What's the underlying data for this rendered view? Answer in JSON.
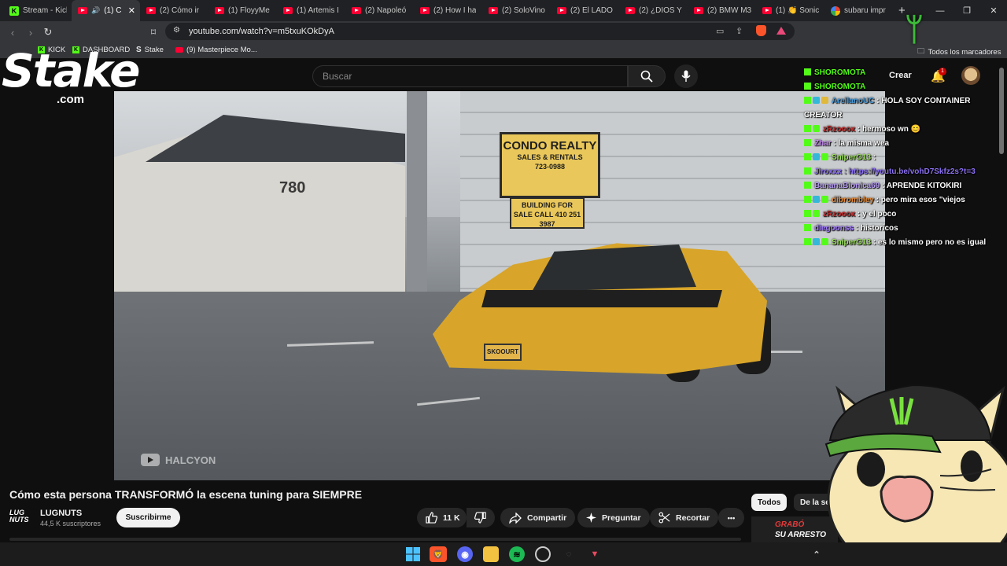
{
  "browser": {
    "tabs": [
      {
        "label": "Stream - Kick",
        "icon": "kick-icon"
      },
      {
        "label": "(1) C",
        "icon": "youtube-icon",
        "active": true
      },
      {
        "label": "(2) Cómo ir",
        "icon": "youtube-icon"
      },
      {
        "label": "(1) FloyyMe",
        "icon": "youtube-icon"
      },
      {
        "label": "(1) Artemis I",
        "icon": "youtube-icon"
      },
      {
        "label": "(2) Napoleó",
        "icon": "youtube-icon"
      },
      {
        "label": "(2) How I ha",
        "icon": "youtube-icon"
      },
      {
        "label": "(2) SoloVino",
        "icon": "youtube-icon"
      },
      {
        "label": "(2) El LADO",
        "icon": "youtube-icon"
      },
      {
        "label": "(2) ¿DIOS Y",
        "icon": "youtube-icon"
      },
      {
        "label": "(2) BMW M3",
        "icon": "youtube-icon"
      },
      {
        "label": "(1) 👏 Sonic",
        "icon": "youtube-icon"
      },
      {
        "label": "subaru impr",
        "icon": "google-icon"
      }
    ],
    "new_tab": "+",
    "url": "youtube.com/watch?v=m5txuKOkDyA",
    "bookmarks": [
      "KICK",
      "DASHBOARD",
      "Stake",
      "(9) Masterpiece Mo..."
    ],
    "all_bookmarks": "Todos los marcadores"
  },
  "youtube": {
    "search_placeholder": "Buscar",
    "create_label": "Crear",
    "notifications_count": "1",
    "video": {
      "watermark": "HALCYON",
      "sign_main": "CONDO REALTY",
      "sign_sub": "SALES & RENTALS",
      "sign_phone": "723-0988",
      "sign2_text": "BUILDING FOR SALE CALL 410 251 3987",
      "building_number": "780",
      "plate": "SKOOURT"
    },
    "title": "Cómo esta persona TRANSFORMÓ la escena tuning para SIEMPRE",
    "channel": {
      "logo_text": "LUG NUTS",
      "name": "LUGNUTS",
      "subscribers": "44,5 K suscriptores",
      "subscribe_label": "Suscribirme"
    },
    "actions": {
      "likes": "11 K",
      "share": "Compartir",
      "ask": "Preguntar",
      "clip": "Recortar",
      "more": "•••"
    },
    "filters": [
      "Todos",
      "De la serie"
    ],
    "thumb_text_red": "GRABÓ",
    "thumb_text_white": "SU ARRESTO"
  },
  "overlay": {
    "stake_logo": "Stake",
    "stake_com": ".com",
    "chat": [
      {
        "user": "SHOROMOTA",
        "text": "",
        "color": "#53fc18",
        "badges": 1
      },
      {
        "user": "SHOROMOTA",
        "text": "",
        "color": "#53fc18",
        "badges": 1
      },
      {
        "user": "ArellanoUC",
        "text": ": HOLA SOY CONTAINER CREATOR",
        "color": "#4a9ad8",
        "badges": 3
      },
      {
        "user": "zRzooox",
        "text": ": hermoso wn 😊",
        "color": "#c42b2b",
        "badges": 2
      },
      {
        "user": "Zhar",
        "text": ": la misma wea",
        "color": "#c78bf0",
        "badges": 1
      },
      {
        "user": "SniperG13",
        "text": ":",
        "color": "#9be35a",
        "badges": 3
      },
      {
        "user": "Jiroxxx",
        "text": ": https://youtu.be/vohD7Skfz2s?t=3",
        "color": "#8a6ff0",
        "badges": 1
      },
      {
        "user": "BananaBionica69",
        "text": ": APRENDE KITOKIRI",
        "color": "#b59cf0",
        "badges": 1
      },
      {
        "user": "dibrombley",
        "text": ": pero mira esos \"viejos",
        "color": "#e08a3a",
        "badges": 3
      },
      {
        "user": "zRzooox",
        "text": ": y el poco",
        "color": "#c42b2b",
        "badges": 2
      },
      {
        "user": "diegoonss",
        "text": ": historicos",
        "color": "#a27bff",
        "badges": 1
      },
      {
        "user": "SniperG13",
        "text": ": es lo mismo pero no es igual",
        "color": "#9be35a",
        "badges": 3
      }
    ]
  }
}
